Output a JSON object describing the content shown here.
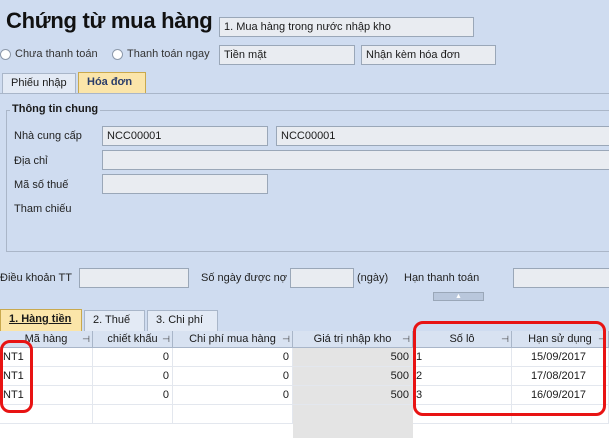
{
  "header": {
    "title": "Chứng từ mua hàng",
    "purchase_type": "1. Mua hàng trong nước nhập kho",
    "payment_options": [
      "Chưa thanh toán",
      "Thanh toán ngay"
    ],
    "payment_method": "Tiền mặt",
    "invoice_option": "Nhận kèm hóa đơn"
  },
  "top_tabs": [
    "Phiếu nhập",
    "Hóa đơn"
  ],
  "general_info": {
    "section_title": "Thông tin chung",
    "supplier_label": "Nhà cung cấp",
    "supplier_code": "NCC00001",
    "supplier_name": "NCC00001",
    "address_label": "Địa chỉ",
    "tax_code_label": "Mã số thuế",
    "reference_label": "Tham chiếu"
  },
  "terms": {
    "payment_terms_label": "Điều khoản TT",
    "debt_days_label": "Số ngày được nợ",
    "days_unit": "(ngày)",
    "due_date_label": "Hạn thanh toán",
    "collapse_arrow": "▲"
  },
  "bottom_tabs": [
    "1. Hàng tiền",
    "2. Thuế",
    "3. Chi phí"
  ],
  "grid": {
    "columns": [
      "Mã hàng",
      "chiết khấu",
      "Chi phí mua hàng",
      "Giá trị nhập kho",
      "Số lô",
      "Hạn sử dụng"
    ],
    "rows": [
      {
        "code": "NT1",
        "discount": "0",
        "purchase_cost": "0",
        "stock_value": "500",
        "lot": "1",
        "expiry": "15/09/2017"
      },
      {
        "code": "NT1",
        "discount": "0",
        "purchase_cost": "0",
        "stock_value": "500",
        "lot": "2",
        "expiry": "17/08/2017"
      },
      {
        "code": "NT1",
        "discount": "0",
        "purchase_cost": "0",
        "stock_value": "500",
        "lot": "3",
        "expiry": "16/09/2017"
      }
    ]
  },
  "colors": {
    "background": "#cfdcf0",
    "highlight": "#e81313",
    "active_tab": "#fbe5a9"
  }
}
